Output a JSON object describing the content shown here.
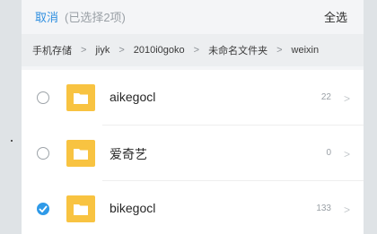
{
  "header": {
    "cancel_label": "取消",
    "selection_status": "(已选择2项)",
    "select_all_label": "全选"
  },
  "breadcrumb": {
    "items": [
      "手机存储",
      "jiyk",
      "2010i0goko",
      "未命名文件夹",
      "weixin"
    ],
    "separator": ">"
  },
  "files": [
    {
      "name": "aikegocl",
      "count": "22",
      "checked": false
    },
    {
      "name": "爱奇艺",
      "count": "0",
      "checked": false
    },
    {
      "name": "bikegocl",
      "count": "133",
      "checked": true
    }
  ],
  "colors": {
    "accent": "#2f8fe0",
    "folder": "#f8c341",
    "checked": "#2f9ae8"
  },
  "icons": {
    "folder": "folder-icon",
    "check": "checkmark-icon",
    "chevron": "chevron-right-icon"
  }
}
